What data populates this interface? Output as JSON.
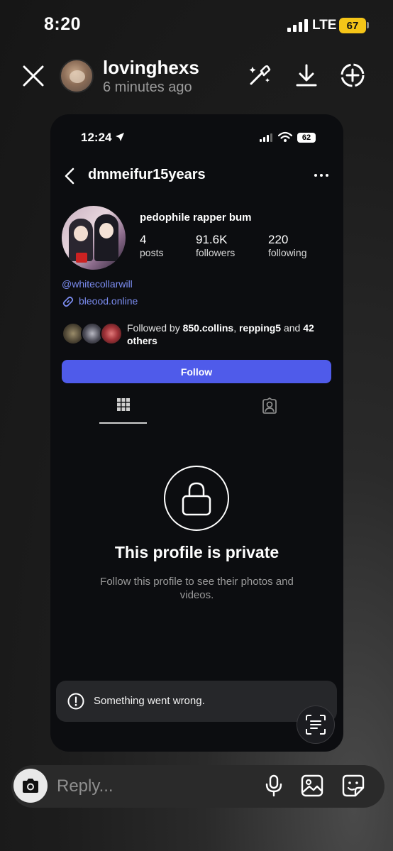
{
  "status_bar": {
    "time": "8:20",
    "network": "LTE",
    "battery": "67"
  },
  "story": {
    "username": "lovinghexs",
    "posted": "6 minutes ago"
  },
  "screenshot": {
    "status_bar": {
      "time": "12:24",
      "battery": "62"
    },
    "profile": {
      "username": "dmmeifur15years",
      "display_name": "pedophile rapper bum",
      "stats": [
        {
          "value": "4",
          "label": "posts"
        },
        {
          "value": "91.6K",
          "label": "followers"
        },
        {
          "value": "220",
          "label": "following"
        }
      ],
      "handle": "@whitecollarwill",
      "website": "bleood.online",
      "followed_by": {
        "prefix": "Followed by ",
        "user1": "850.collins",
        "sep": ", ",
        "user2": "repping5",
        "and": " and ",
        "others": "42 others"
      },
      "follow_label": "Follow"
    },
    "private": {
      "title": "This profile is private",
      "subtitle": "Follow this profile to see their photos and videos."
    },
    "toast": "Something went wrong."
  },
  "reply": {
    "placeholder": "Reply..."
  },
  "icons": {
    "close": "close-icon",
    "effects": "magic-wand-icon",
    "download": "download-icon",
    "add": "add-circle-icon",
    "camera": "camera-icon",
    "mic": "microphone-icon",
    "gallery": "image-icon",
    "sticker": "sticker-icon",
    "lock": "lock-icon",
    "alert": "alert-icon",
    "scan": "scan-text-icon"
  },
  "colors": {
    "accent": "#4f5bea",
    "link": "#7b8cf0",
    "battery": "#f5c518"
  }
}
